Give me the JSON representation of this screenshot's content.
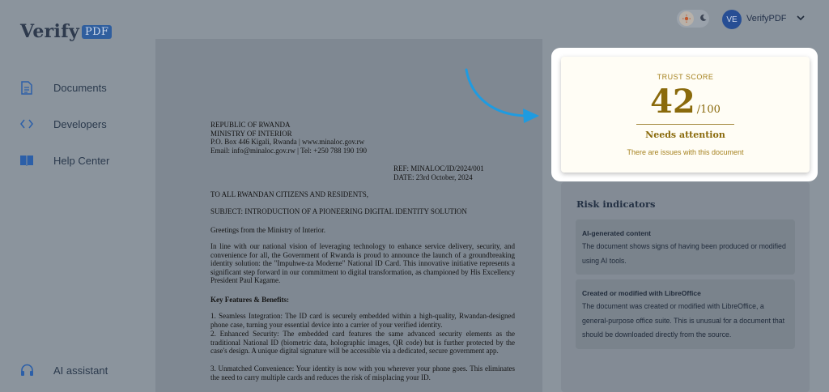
{
  "brand": {
    "name": "Verify",
    "badge": "PDF"
  },
  "sidebar": {
    "items": [
      {
        "label": "Documents",
        "icon": "document-icon"
      },
      {
        "label": "Developers",
        "icon": "code-icon"
      },
      {
        "label": "Help Center",
        "icon": "book-icon"
      }
    ],
    "assistant": {
      "label": "AI assistant",
      "icon": "headset-icon"
    }
  },
  "header": {
    "avatar_initials": "VE",
    "user_name": "VerifyPDF"
  },
  "document": {
    "header_lines": [
      "REPUBLIC OF RWANDA",
      "MINISTRY OF INTERIOR",
      "P.O. Box 446 Kigali, Rwanda | www.minaloc.gov.rw",
      "Email: info@minaloc.gov.rw | Tel: +250 788 190 190"
    ],
    "ref": "REF: MINALOC/ID/2024/001",
    "date": "DATE: 23rd October, 2024",
    "addressee": "TO ALL RWANDAN CITIZENS AND RESIDENTS,",
    "subject": "SUBJECT: INTRODUCTION OF A PIONEERING DIGITAL IDENTITY SOLUTION",
    "greeting": "Greetings from the Ministry of Interior.",
    "intro": "In line with our national vision of leveraging technology to enhance service delivery, security, and convenience for all, the Government of Rwanda is proud to announce the launch of a groundbreaking identity solution: the \"Impuhwe-za Moderne\" National ID Card. This innovative initiative represents a significant step forward in our commitment to digital transformation, as championed by His Excellency President Paul Kagame.",
    "features_heading": "Key Features & Benefits:",
    "features": [
      "1.   Seamless Integration: The ID card is securely embedded within a high-quality, Rwandan-designed phone case, turning your essential device into a carrier of your verified identity.",
      "2.   Enhanced Security: The embedded card features the same advanced security elements as the traditional National ID (biometric data, holographic images, QR code) but is further protected by the case's design. A unique digital signature will be accessible via a dedicated, secure government app.",
      "3.   Unmatched Convenience: Your identity is now with you wherever your phone goes. This eliminates the need to carry multiple cards and reduces the risk of misplacing your ID."
    ]
  },
  "trust": {
    "label": "TRUST SCORE",
    "score": "42",
    "max": "/100",
    "status": "Needs attention",
    "subtext": "There are issues with this document"
  },
  "risk": {
    "title": "Risk indicators",
    "items": [
      {
        "title": "AI-generated content",
        "description": "The document shows signs of having been produced or modified using AI tools."
      },
      {
        "title": "Created or modified with LibreOffice",
        "description": "The document was created or modified with LibreOffice, a general-purpose office suite. This is unusual for a document that should be downloaded directly from the source."
      }
    ]
  },
  "colors": {
    "accent_gold": "#8a6a0c",
    "arrow_blue": "#1f9be0",
    "brand_blue": "#2f5e9e"
  }
}
